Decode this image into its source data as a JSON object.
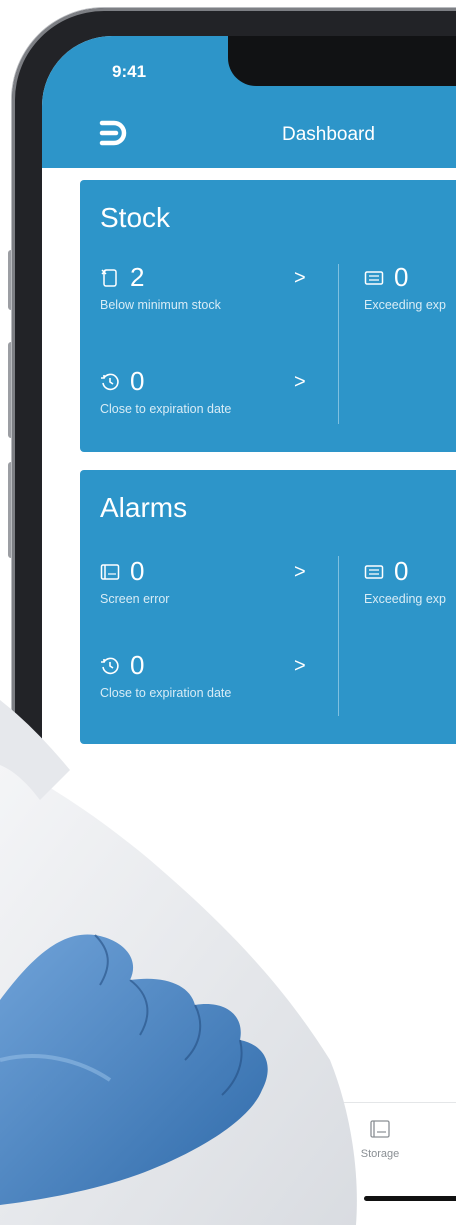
{
  "status_bar": {
    "time": "9:41"
  },
  "header": {
    "title": "Dashboard",
    "logo_icon": "brand-d-logo-icon"
  },
  "stock": {
    "title": "Stock",
    "items": [
      {
        "value": "2",
        "label": "Below minimum stock",
        "icon": "document-x-icon"
      },
      {
        "value": "0",
        "label": "Close to expiration date",
        "icon": "history-clock-icon"
      },
      {
        "value": "0",
        "label": "Exceeding exp",
        "icon": "monitor-card-icon"
      }
    ]
  },
  "alarms": {
    "title": "Alarms",
    "items": [
      {
        "value": "0",
        "label": "Screen error",
        "icon": "screen-error-icon"
      },
      {
        "value": "0",
        "label": "Close to expiration date",
        "icon": "history-clock-icon"
      },
      {
        "value": "0",
        "label": "Exceeding exp",
        "icon": "monitor-card-icon"
      }
    ]
  },
  "nav": {
    "storage_label": "Storage",
    "storage_icon": "storage-box-icon"
  },
  "colors": {
    "primary": "#2d95c9",
    "primary_light": "#d8ecf6",
    "frame": "#222327",
    "glove": "#4e86c4"
  }
}
